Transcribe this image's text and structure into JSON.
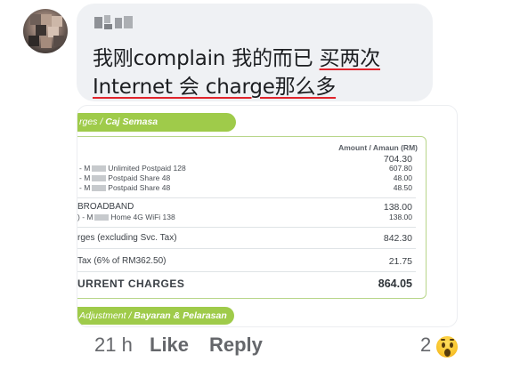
{
  "comment": {
    "text_line1_a": "我刚complain 我的而已 ",
    "text_line1_b": "买两次",
    "text_line2": "Internet 会 charge那么多"
  },
  "statement": {
    "section_header": "rges / ",
    "section_header_italic": "Caj Semasa",
    "amount_header": "Amount / Amaun (RM)",
    "mobile_total": "704.30",
    "mobile_lines": [
      {
        "prefix": "- M",
        "label": "Unlimited Postpaid 128",
        "amount": "607.80"
      },
      {
        "prefix": "- M",
        "label": "Postpaid Share 48",
        "amount": "48.00"
      },
      {
        "prefix": "- M",
        "label": "Postpaid Share 48",
        "amount": "48.50"
      }
    ],
    "broadband_label": "BROADBAND",
    "broadband_total": "138.00",
    "broadband_line": {
      "prefix": ") - M",
      "label": "Home 4G WiFi 138",
      "amount": "138.00"
    },
    "subtotal_label": "rges (excluding Svc. Tax)",
    "subtotal_amount": "842.30",
    "tax_label": "Tax (6% of RM362.50)",
    "tax_amount": "21.75",
    "total_label": "URRENT CHARGES",
    "total_amount": "864.05",
    "footer_label": "Adjustment / ",
    "footer_label_italic": "Bayaran & Pelarasan"
  },
  "actions": {
    "time": "21 h",
    "like_label": "Like",
    "reply_label": "Reply",
    "reaction_count": "2",
    "reaction_icon": "wow-emoji-icon"
  },
  "colors": {
    "bubble_bg": "#eff1f4",
    "accent_green": "#9fcb4a",
    "underline_red": "#e0242c",
    "action_gray": "#65676b"
  }
}
